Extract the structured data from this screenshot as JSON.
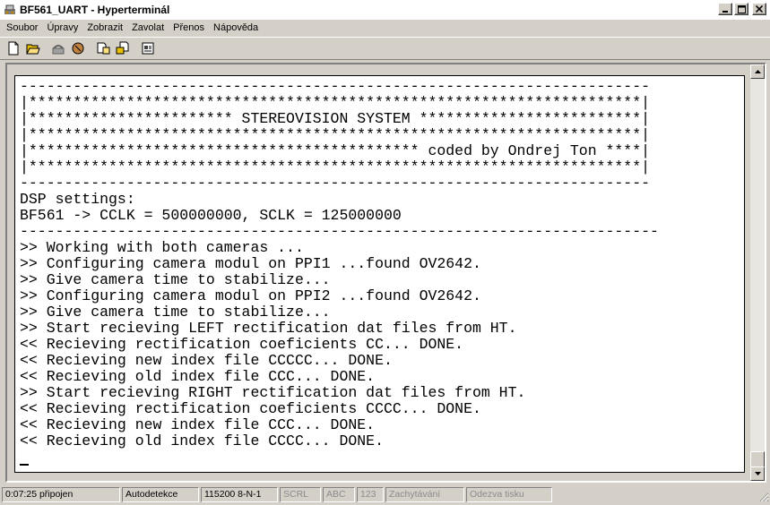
{
  "window": {
    "title": "BF561_UART - Hyperterminál",
    "controls": [
      "_",
      "□",
      "×"
    ]
  },
  "menu": [
    "Soubor",
    "Úpravy",
    "Zobrazit",
    "Zavolat",
    "Přenos",
    "Nápověda"
  ],
  "toolbar": {
    "icons": [
      "new-icon",
      "open-icon",
      "call-icon",
      "disconnect-icon",
      "send-icon",
      "receive-icon",
      "properties-icon"
    ]
  },
  "terminal": {
    "lines": [
      "-----------------------------------------------------------------------",
      "|*********************************************************************|",
      "|*********************** STEREOVISION SYSTEM *************************|",
      "|*********************************************************************|",
      "|******************************************** coded by Ondrej Ton ****|",
      "|*********************************************************************|",
      "-----------------------------------------------------------------------",
      "DSP settings:",
      "BF561 -> CCLK = 500000000, SCLK = 125000000",
      "------------------------------------------------------------------------",
      ">> Working with both cameras ...",
      ">> Configuring camera modul on PPI1 ...found OV2642.",
      ">> Give camera time to stabilize...",
      ">> Configuring camera modul on PPI2 ...found OV2642.",
      ">> Give camera time to stabilize...",
      ">> Start recieving LEFT rectification dat files from HT.",
      "<< Recieving rectification coeficients CC... DONE.",
      "<< Recieving new index file CCCCC... DONE.",
      "<< Recieving old index file CCC... DONE.",
      ">> Start recieving RIGHT rectification dat files from HT.",
      "<< Recieving rectification coeficients CCCC... DONE.",
      "<< Recieving new index file CCC... DONE.",
      "<< Recieving old index file CCCC... DONE.",
      "",
      ""
    ]
  },
  "status": {
    "connected": "0:07:25 připojen",
    "detect": "Autodetekce",
    "port": "115200 8-N-1",
    "scrl": "SCRL",
    "abc": "ABC",
    "num": "123",
    "capture": "Zachytávání",
    "print": "Odezva tisku"
  }
}
